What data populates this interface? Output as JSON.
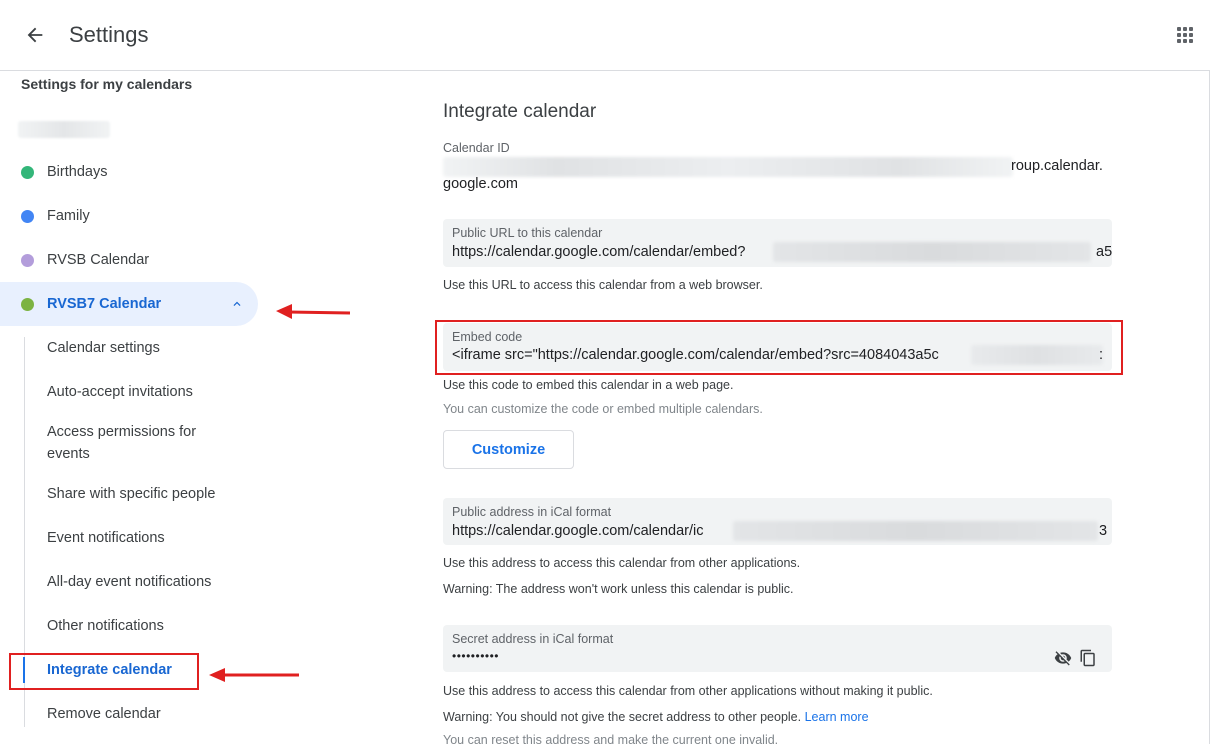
{
  "header": {
    "title": "Settings",
    "back_icon": "arrow-back-icon",
    "apps_icon": "apps-grid-icon"
  },
  "sidebar": {
    "heading": "Settings for my calendars",
    "calendars": [
      {
        "label": "Birthdays",
        "color": "#33b679"
      },
      {
        "label": "Family",
        "color": "#4285f4"
      },
      {
        "label": "RVSB Calendar",
        "color": "#b39ddb"
      },
      {
        "label": "RVSB7 Calendar",
        "color": "#7cb342"
      }
    ],
    "sub_items": [
      {
        "label": "Calendar settings"
      },
      {
        "label": "Auto-accept invitations"
      },
      {
        "label": "Access permissions for events"
      },
      {
        "label": "Share with specific people"
      },
      {
        "label": "Event notifications"
      },
      {
        "label": "All-day event notifications"
      },
      {
        "label": "Other notifications"
      },
      {
        "label": "Integrate calendar"
      },
      {
        "label": "Remove calendar"
      }
    ]
  },
  "main": {
    "title": "Integrate calendar",
    "calendar_id": {
      "label": "Calendar ID",
      "value_line1": "roup.calendar.",
      "value_line2": "google.com"
    },
    "public_url": {
      "label": "Public URL to this calendar",
      "value": "https://calendar.google.com/calendar/embed?",
      "tail": "a5",
      "help": "Use this URL to access this calendar from a web browser."
    },
    "embed_code": {
      "label": "Embed code",
      "value": "<iframe src=\"https://calendar.google.com/calendar/embed?src=4084043a5c",
      "tail": ":",
      "help1": "Use this code to embed this calendar in a web page.",
      "help2": "You can customize the code or embed multiple calendars.",
      "button": "Customize"
    },
    "public_ical": {
      "label": "Public address in iCal format",
      "value": "https://calendar.google.com/calendar/ic",
      "tail": "3",
      "help1": "Use this address to access this calendar from other applications.",
      "help2": "Warning: The address won't work unless this calendar is public."
    },
    "secret_ical": {
      "label": "Secret address in iCal format",
      "value": "••••••••••",
      "help1": "Use this address to access this calendar from other applications without making it public.",
      "help2": "Warning: You should not give the secret address to other people.",
      "help2_link": "Learn more",
      "help3": "You can reset this address and make the current one invalid.",
      "visibility_icon": "visibility-off-icon",
      "copy_icon": "copy-icon"
    }
  },
  "colors": {
    "accent": "#1a73e8",
    "annotation_red": "#e02020",
    "active_bg": "#e8f0fe"
  }
}
